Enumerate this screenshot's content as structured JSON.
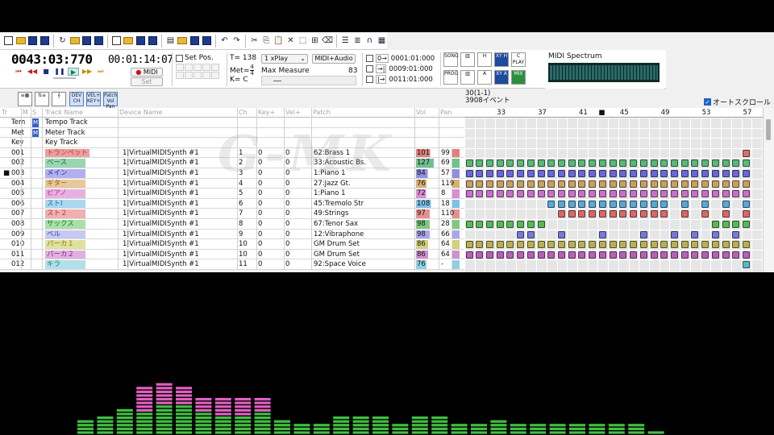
{
  "toolbar": {
    "icons": [
      "new-file-icon",
      "open-folder-icon",
      "save-icon",
      "save-as-icon",
      "reload-icon",
      "open-folder-icon",
      "save-icon",
      "save-as-icon",
      "new-file-icon",
      "open-folder-icon",
      "save-icon",
      "save-as-icon",
      "doc-icon",
      "open-folder-icon",
      "save-icon",
      "save-as-icon",
      "undo-icon",
      "redo-icon",
      "cut-icon",
      "copy-icon",
      "paste-icon",
      "delete-icon",
      "select-icon",
      "insert-icon",
      "erase-icon",
      "list-icon",
      "list2-icon",
      "headphone-icon",
      "grid-icon"
    ]
  },
  "transport": {
    "position": "0043:03:770",
    "time": "00:01:14:07",
    "midi_label": "MIDI",
    "set_label": "Set",
    "set_pos_label": "Set Pos.",
    "tempo_label": "T=",
    "tempo": "138",
    "meter_label": "Met=",
    "meter_num": "4",
    "meter_den": "4",
    "key_label": "K=",
    "key": "C",
    "play_mode": "1 xPlay",
    "output_mode": "MIDI+Audio",
    "max_measure_label": "Max Measure",
    "max_measure": "83",
    "markers": [
      "0001:01:000",
      "0009:01:000",
      "0011:01:000"
    ]
  },
  "tools": {
    "right_buttons": [
      {
        "name": "song-button",
        "label": "SONG"
      },
      {
        "name": "mixer-button",
        "label": ""
      },
      {
        "name": "mixer-h-button",
        "label": "H"
      },
      {
        "name": "xy-h-button",
        "label": "XY H"
      },
      {
        "name": "c-play-button",
        "label": "C PLAY"
      },
      {
        "name": "prog-button",
        "label": "PROG"
      },
      {
        "name": "table-button",
        "label": ""
      },
      {
        "name": "mixer-a-button",
        "label": "A"
      },
      {
        "name": "xy-a-button",
        "label": "XY A"
      },
      {
        "name": "mix-button",
        "label": "MIX"
      }
    ]
  },
  "spectrum_box": {
    "title": "MIDI Spectrum"
  },
  "subtoolbar": {
    "buttons": [
      "DEV CH",
      "VEL+ KEY+",
      "Patch Vol Pan"
    ],
    "position_line1": "30(1-1)",
    "position_line2": "3908イベント",
    "autoscroll_label": "オートスクロール",
    "autoscroll_checked": true
  },
  "table": {
    "headers": [
      "Tr",
      "M",
      "S",
      "Track Name",
      "Device Name",
      "Ch",
      "Key+",
      "Vel+",
      "Patch",
      "Vol",
      "Pan"
    ],
    "special_rows": [
      {
        "id": "Tem",
        "m": "M",
        "name": "Tempo Track"
      },
      {
        "id": "Met",
        "m": "M",
        "name": "Meter Track"
      },
      {
        "id": "Key",
        "m": "",
        "name": "Key Track"
      }
    ],
    "tracks": [
      {
        "no": "001",
        "name": "トランペット",
        "color": "#e8a0a0",
        "text": "#d23030",
        "device": "1|VirtualMIDISynth #1",
        "ch": "1",
        "key": "0",
        "vel": "0",
        "patch": "62:Brass 1",
        "vol": "101",
        "pan": "99",
        "volc": "#e08080",
        "panc": "#e08080"
      },
      {
        "no": "002",
        "name": "ベース",
        "color": "#9ad6b0",
        "text": "#207040",
        "device": "1|VirtualMIDISynth #1",
        "ch": "2",
        "key": "0",
        "vel": "0",
        "patch": "33:Acoustic Bs.",
        "vol": "127",
        "pan": "69",
        "volc": "#70c090",
        "panc": "#70c090"
      },
      {
        "no": "003",
        "name": "メイン",
        "color": "#b0b0f0",
        "text": "#2828b0",
        "device": "1|VirtualMIDISynth #1",
        "ch": "3",
        "key": "0",
        "vel": "0",
        "patch": "1:Piano 1",
        "vol": "84",
        "pan": "57",
        "volc": "#9090e0",
        "panc": "#9090e0",
        "current": true
      },
      {
        "no": "004",
        "name": "ギター",
        "color": "#e8c89a",
        "text": "#a06010",
        "device": "1|VirtualMIDISynth #1",
        "ch": "4",
        "key": "0",
        "vel": "0",
        "patch": "27:Jazz Gt.",
        "vol": "76",
        "pan": "119",
        "volc": "#d8b070",
        "panc": "#d8b070"
      },
      {
        "no": "005",
        "name": "ピアノ",
        "color": "#e8b0e0",
        "text": "#b030a0",
        "device": "1|VirtualMIDISynth #1",
        "ch": "5",
        "key": "0",
        "vel": "0",
        "patch": "1:Piano 1",
        "vol": "72",
        "pan": "8",
        "volc": "#d890d0",
        "panc": "#d890d0"
      },
      {
        "no": "006",
        "name": "ストⅠ",
        "color": "#a8d8f0",
        "text": "#2070a0",
        "device": "1|VirtualMIDISynth #1",
        "ch": "6",
        "key": "0",
        "vel": "0",
        "patch": "45:Tremolo Str",
        "vol": "108",
        "pan": "18",
        "volc": "#80c0e8",
        "panc": "#80c0e8"
      },
      {
        "no": "007",
        "name": "スト２",
        "color": "#f0b0b0",
        "text": "#c03030",
        "device": "1|VirtualMIDISynth #1",
        "ch": "7",
        "key": "0",
        "vel": "0",
        "patch": "49:Strings",
        "vol": "97",
        "pan": "110",
        "volc": "#e89090",
        "panc": "#e89090"
      },
      {
        "no": "008",
        "name": "サックス",
        "color": "#a8e0a8",
        "text": "#208020",
        "device": "1|VirtualMIDISynth #1",
        "ch": "8",
        "key": "0",
        "vel": "0",
        "patch": "67:Tenor Sax",
        "vol": "98",
        "pan": "28",
        "volc": "#80c880",
        "panc": "#80c880"
      },
      {
        "no": "009",
        "name": "ベル",
        "color": "#c8c8f0",
        "text": "#4040a0",
        "device": "1|VirtualMIDISynth #1",
        "ch": "9",
        "key": "0",
        "vel": "0",
        "patch": "12:Vibraphone",
        "vol": "98",
        "pan": "66",
        "volc": "#a8a8e8",
        "panc": "#a8a8e8"
      },
      {
        "no": "010",
        "name": "パーカ１",
        "color": "#e0e0a0",
        "text": "#808010",
        "device": "1|VirtualMIDISynth #1",
        "ch": "10",
        "key": "0",
        "vel": "0",
        "patch": "GM Drum Set",
        "vol": "86",
        "pan": "64",
        "volc": "#d0d080",
        "panc": "#d0d080"
      },
      {
        "no": "011",
        "name": "パーカ２",
        "color": "#e0b0e0",
        "text": "#902090",
        "device": "1|VirtualMIDISynth #1",
        "ch": "10",
        "key": "0",
        "vel": "0",
        "patch": "GM Drum Set",
        "vol": "86",
        "pan": "64",
        "volc": "#d090d0",
        "panc": "#d090d0"
      },
      {
        "no": "012",
        "name": "キラ",
        "color": "#b0e0e8",
        "text": "#208080",
        "device": "1|VirtualMIDISynth #1",
        "ch": "11",
        "key": "0",
        "vel": "0",
        "patch": "92:Space Voice",
        "vol": "76",
        "pan": "-",
        "volc": "#90d0e0",
        "panc": "#90d0e0"
      }
    ]
  },
  "pianoroll": {
    "measure_labels": [
      "33",
      "37",
      "41",
      "45",
      "49",
      "53",
      "57"
    ],
    "cursor_symbol": "■",
    "first_measure": 30,
    "visible_measures": 29,
    "cell_colors": [
      "#d87070",
      "#58b878",
      "#6868d8",
      "#c8a060",
      "#c870c8",
      "#58a8d8",
      "#d86868",
      "#58b858",
      "#7878d8",
      "#b8b050",
      "#b860b8",
      "#58b8c8"
    ],
    "cells": [
      [
        57
      ],
      [
        30,
        31,
        32,
        33,
        34,
        35,
        36,
        37,
        38,
        39,
        40,
        41,
        42,
        43,
        44,
        45,
        46,
        47,
        48,
        49,
        50,
        51,
        52,
        53,
        54,
        55,
        56,
        57
      ],
      [
        30,
        31,
        32,
        33,
        34,
        35,
        36,
        37,
        38,
        39,
        40,
        41,
        42,
        43,
        44,
        45,
        46,
        47,
        48,
        49,
        50,
        51,
        52,
        53,
        54,
        55,
        56,
        57
      ],
      [
        30,
        31,
        32,
        33,
        34,
        35,
        36,
        37,
        38,
        39,
        40,
        41,
        42,
        43,
        44,
        45,
        46,
        47,
        48,
        49,
        50,
        51,
        52,
        53,
        54,
        55,
        56,
        57
      ],
      [
        30,
        31,
        32,
        33,
        34,
        35,
        36,
        37,
        38,
        39,
        40,
        41,
        42,
        43,
        44,
        45,
        46,
        47,
        48,
        49,
        50,
        51,
        52,
        53,
        54,
        55,
        56,
        57
      ],
      [
        38,
        39,
        40,
        41,
        42,
        43,
        44,
        45,
        46,
        47,
        48,
        49,
        51,
        53,
        55,
        57
      ],
      [
        39,
        40,
        41,
        42,
        43,
        44,
        45,
        46,
        47,
        48,
        49,
        51,
        53,
        55,
        57
      ],
      [
        30,
        31,
        32,
        33,
        34,
        35,
        36,
        37,
        54,
        55,
        56,
        57
      ],
      [
        35,
        36,
        39,
        43,
        47,
        50,
        52,
        54,
        56
      ],
      [
        30,
        31,
        32,
        33,
        34,
        35,
        36,
        37,
        38,
        39,
        40,
        41,
        42,
        43,
        44,
        45,
        46,
        47,
        48,
        49,
        50,
        51,
        52,
        53,
        54,
        55,
        56,
        57
      ],
      [
        30,
        31,
        32,
        33,
        34,
        35,
        36,
        37,
        38,
        39,
        40,
        41,
        42,
        43,
        44,
        45,
        46,
        47,
        48,
        49,
        50,
        51,
        52,
        53,
        54,
        55,
        56,
        57
      ],
      [
        57
      ]
    ]
  },
  "spectrum": {
    "levels": [
      0.1,
      0.12,
      0.15,
      0.23,
      0.28,
      0.31,
      0.23,
      0.19,
      0.19,
      0.2,
      0.1,
      0.08,
      0.08,
      0.12,
      0.12,
      0.12,
      0.08,
      0.12,
      0.12,
      0.08,
      0.08,
      0.1,
      0.08,
      0.08,
      0.08,
      0.08,
      0.08,
      0.08,
      0.08,
      0.03
    ],
    "peak_levels": [
      0.1,
      0.12,
      0.15,
      0.3,
      0.33,
      0.31,
      0.23,
      0.22,
      0.22,
      0.22,
      0.1,
      0.08,
      0.08,
      0.12,
      0.12,
      0.12,
      0.08,
      0.12,
      0.12,
      0.08,
      0.08,
      0.1,
      0.08,
      0.08,
      0.08,
      0.08,
      0.08,
      0.08,
      0.08,
      0.03
    ],
    "color_low": "#40c040",
    "color_high": "#e060c0"
  }
}
